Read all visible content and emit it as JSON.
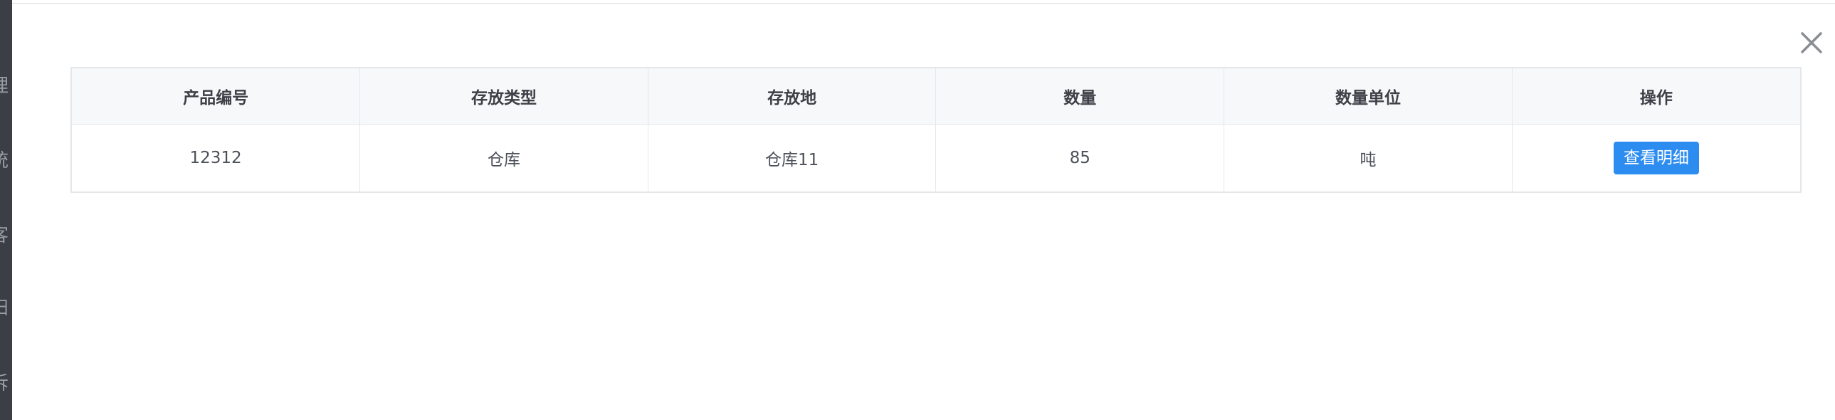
{
  "backdrop": {
    "fragments": [
      "理",
      "统",
      "客",
      "扫",
      "诉"
    ]
  },
  "dialog": {
    "close_icon": "close-icon"
  },
  "table": {
    "columns": [
      "产品编号",
      "存放类型",
      "存放地",
      "数量",
      "数量单位",
      "操作"
    ],
    "rows": [
      {
        "product_no": "12312",
        "storage_type": "仓库",
        "location": "仓库11",
        "quantity": "85",
        "unit": "吨",
        "action_label": "查看明细"
      }
    ]
  },
  "colors": {
    "primary_button": "#2d8cf0",
    "header_bg": "#f7f8fa",
    "border": "#e4e6ea",
    "backdrop": "#3b3e44"
  }
}
